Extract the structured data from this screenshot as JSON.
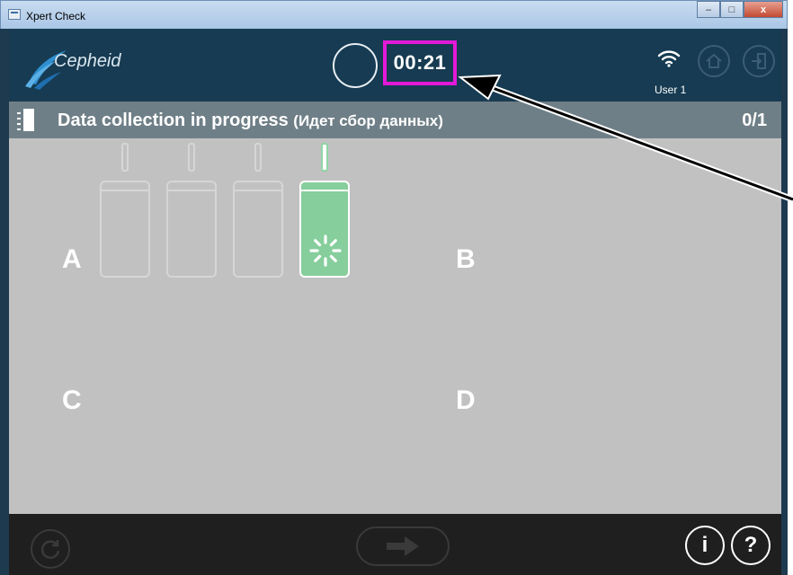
{
  "window": {
    "title": "Xpert Check",
    "minimize_glyph": "–",
    "maximize_glyph": "□",
    "close_glyph": "x"
  },
  "header": {
    "logo_text": "Cepheid",
    "timer": "00:21",
    "user": "User 1",
    "wifi_icon": "wifi-icon",
    "home_icon": "home-icon",
    "exit_icon": "exit-icon",
    "highlight_color": "#e319d8"
  },
  "status": {
    "text": "Data collection in progress",
    "translation": "(Идет сбор данных)",
    "count": "0/1"
  },
  "modules": {
    "labels": [
      "A",
      "B",
      "C",
      "D"
    ],
    "active_color": "#86ce9c"
  },
  "footer": {
    "info_label": "i",
    "help_label": "?"
  }
}
